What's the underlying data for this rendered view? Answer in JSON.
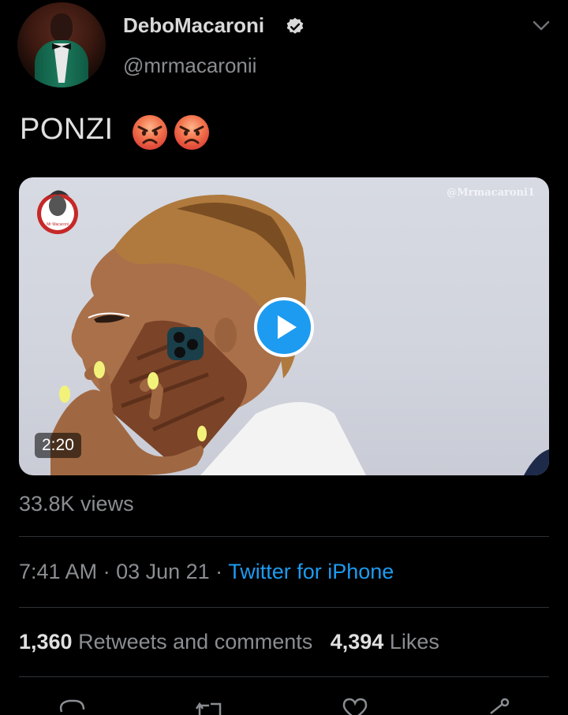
{
  "author": {
    "name": "DeboMacaroni",
    "handle": "@mrmacaronii",
    "verified_icon": "verified-badge-icon"
  },
  "tweet": {
    "text": "PONZI",
    "emojis": [
      "angry-face",
      "angry-face"
    ]
  },
  "media": {
    "watermark": "@Mrmacaroni1",
    "logo_text": "Mr Macaroni",
    "duration": "2:20",
    "play_icon": "play-icon"
  },
  "views": "33.8K views",
  "meta": {
    "time": "7:41 AM",
    "separator": " · ",
    "date": "03 Jun 21",
    "source": "Twitter for iPhone"
  },
  "stats": {
    "retweets_count": "1,360",
    "retweets_label": "Retweets and comments",
    "likes_count": "4,394",
    "likes_label": "Likes"
  },
  "actions": [
    "reply-icon",
    "retweet-icon",
    "like-icon",
    "share-icon"
  ],
  "colors": {
    "background": "#000000",
    "accent": "#1d9bf0",
    "secondary_text": "#8a8d91"
  }
}
